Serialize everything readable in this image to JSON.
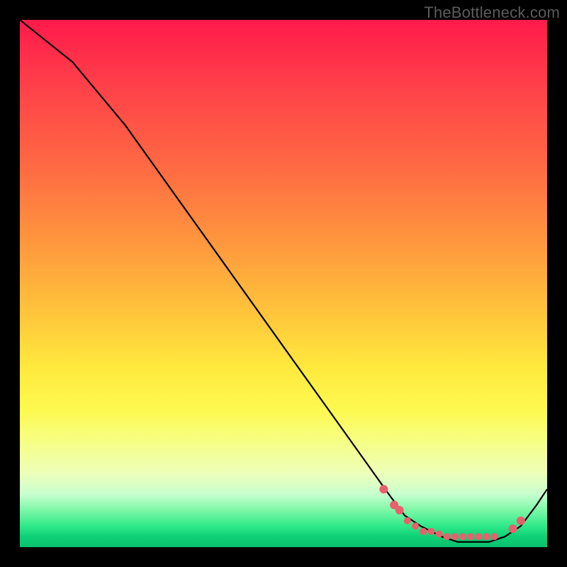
{
  "watermark": "TheBottleneck.com",
  "chart_data": {
    "type": "line",
    "title": "",
    "xlabel": "",
    "ylabel": "",
    "xlim": [
      0,
      100
    ],
    "ylim": [
      0,
      100
    ],
    "series": [
      {
        "name": "bottleneck-curve",
        "x": [
          0,
          5,
          10,
          15,
          20,
          25,
          30,
          35,
          40,
          45,
          50,
          55,
          60,
          65,
          70,
          73,
          76,
          80,
          83,
          86,
          89,
          92,
          95,
          98,
          100
        ],
        "y": [
          100,
          96,
          92,
          86,
          80,
          73,
          66,
          59,
          52,
          45,
          38,
          31,
          24,
          17,
          10,
          6,
          4,
          2,
          1,
          1,
          1,
          2,
          4,
          8,
          11
        ]
      }
    ],
    "markers": {
      "name": "highlighted-points",
      "x": [
        69,
        71,
        72,
        73.5,
        75,
        76.5,
        78,
        79.5,
        81,
        82.5,
        84,
        85.5,
        87,
        88.5,
        90,
        93.5,
        95
      ],
      "y": [
        11,
        8,
        7,
        5,
        4,
        3,
        3,
        2.5,
        2,
        2,
        2,
        2,
        2,
        2,
        2,
        3.5,
        5
      ]
    },
    "background_gradient": {
      "top": "#ff1a4b",
      "mid": "#ffe93e",
      "bottom": "#0ac06d"
    }
  }
}
